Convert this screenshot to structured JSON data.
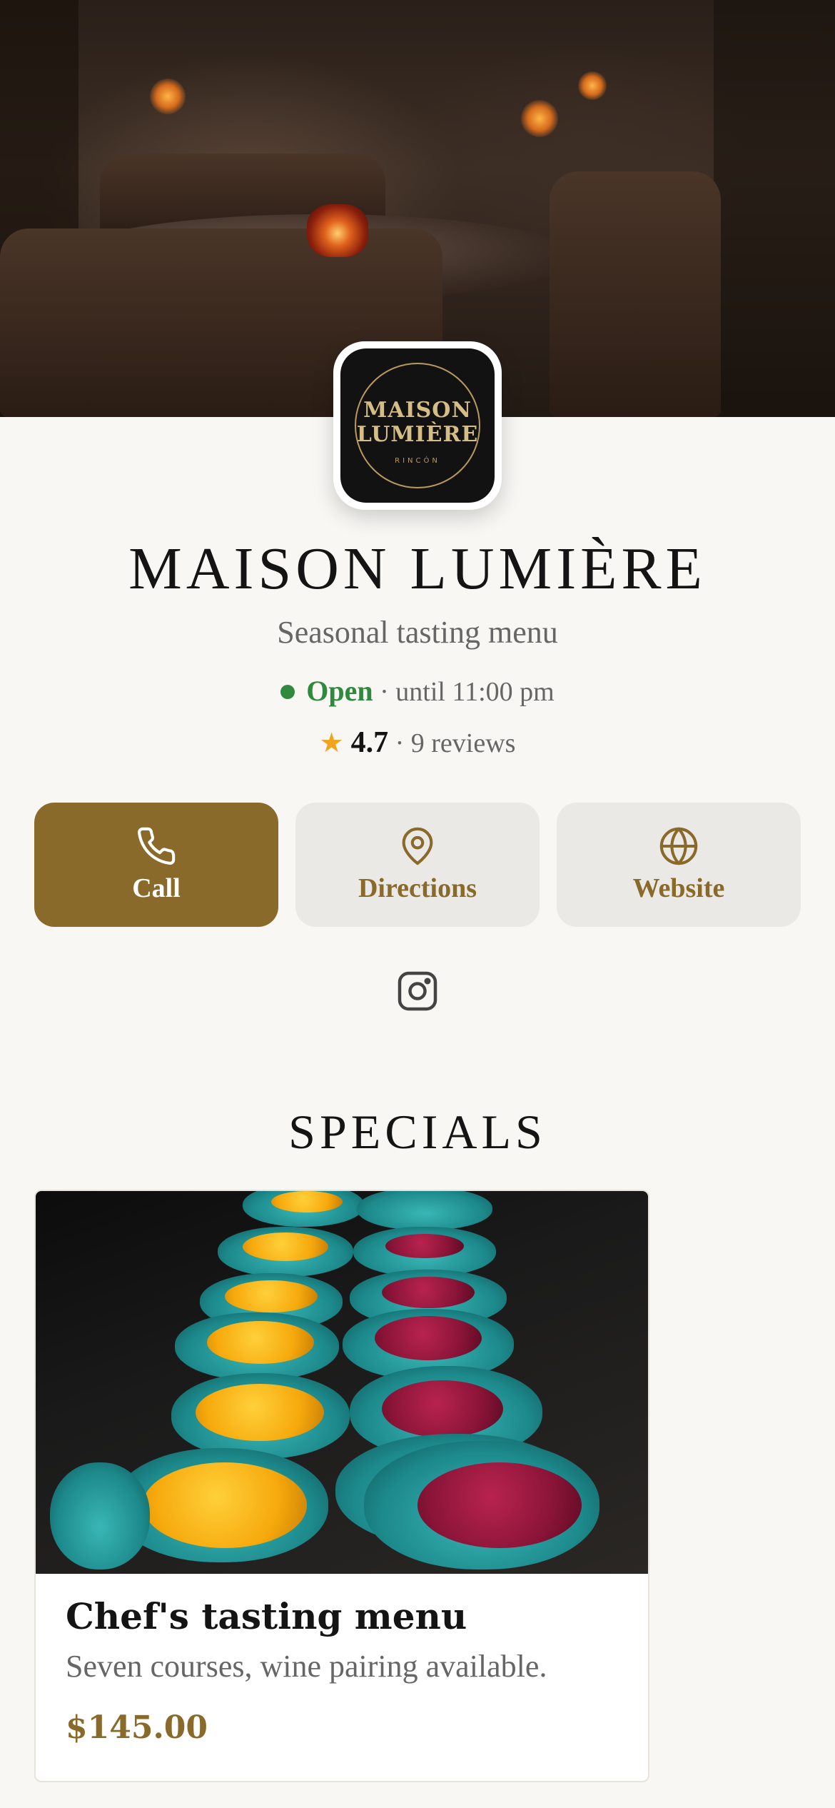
{
  "logo": {
    "line1": "MAISON",
    "line2": "LUMIÈRE",
    "sub": "RINCÓN"
  },
  "restaurant": {
    "name": "MAISON LUMIÈRE",
    "tagline": "Seasonal tasting menu",
    "status_label": "Open",
    "status_detail": "· until 11:00 pm",
    "rating": "4.7",
    "reviews": "· 9 reviews"
  },
  "actions": {
    "call_label": "Call",
    "directions_label": "Directions",
    "website_label": "Website"
  },
  "icons": [
    "phone-icon",
    "map-pin-icon",
    "globe-icon",
    "instagram-icon",
    "star-icon"
  ],
  "colors": {
    "accent": "#8a6a2a",
    "open": "#2f8a3e",
    "star": "#f0a31b",
    "background": "#f8f7f4"
  },
  "specials": {
    "heading": "SPECIALS",
    "items": [
      {
        "title": "Chef's tasting menu",
        "description": "Seven courses, wine pairing available.",
        "price": "$145.00"
      }
    ]
  }
}
